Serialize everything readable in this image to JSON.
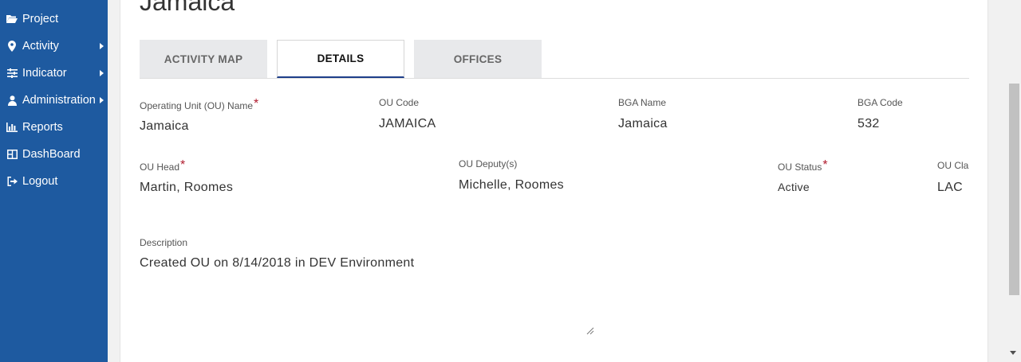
{
  "sidebar": {
    "items": [
      {
        "label": "Project",
        "icon": "folder-open-icon",
        "has_submenu": false
      },
      {
        "label": "Activity",
        "icon": "map-pin-icon",
        "has_submenu": true
      },
      {
        "label": "Indicator",
        "icon": "sliders-icon",
        "has_submenu": true
      },
      {
        "label": "Administration",
        "icon": "user-icon",
        "has_submenu": true
      },
      {
        "label": "Reports",
        "icon": "bar-chart-icon",
        "has_submenu": false
      },
      {
        "label": "DashBoard",
        "icon": "dashboard-icon",
        "has_submenu": false
      },
      {
        "label": "Logout",
        "icon": "sign-out-icon",
        "has_submenu": false
      }
    ]
  },
  "page": {
    "title": "Jamaica"
  },
  "tabs": [
    {
      "label": "ACTIVITY MAP",
      "active": false
    },
    {
      "label": "DETAILS",
      "active": true
    },
    {
      "label": "OFFICES",
      "active": false
    }
  ],
  "fields": {
    "ou_name": {
      "label": "Operating Unit (OU) Name",
      "value": "Jamaica",
      "required": "*"
    },
    "ou_code": {
      "label": "OU Code",
      "value": "JAMAICA"
    },
    "bga_name": {
      "label": "BGA Name",
      "value": "Jamaica"
    },
    "bga_code": {
      "label": "BGA Code",
      "value": "532"
    },
    "ou_head": {
      "label": "OU Head",
      "value": "Martin, Roomes",
      "required": "*"
    },
    "ou_deputies": {
      "label": "OU Deputy(s)",
      "value": "Michelle, Roomes"
    },
    "ou_status": {
      "label": "OU Status",
      "value": "Active",
      "required": "*"
    },
    "ou_class": {
      "label": "OU Cla",
      "value": "LAC"
    },
    "description": {
      "label": "Description",
      "value": "Created OU on 8/14/2018 in DEV Environment"
    }
  },
  "colors": {
    "sidebar_bg": "#1e5aa0",
    "required_marker": "#b01c2e",
    "active_tab_underline": "#1e3f8a",
    "inactive_tab_bg": "#e8e9eb"
  }
}
